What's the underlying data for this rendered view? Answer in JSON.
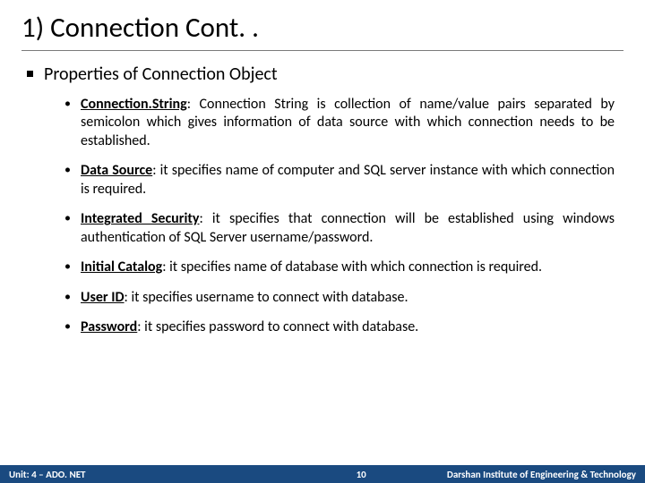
{
  "title": "1) Connection Cont. .",
  "section_heading": "Properties of Connection Object",
  "items": [
    {
      "term": "Connection.String",
      "desc": ": Connection String is collection of name/value pairs separated by semicolon which gives information of data source with which connection needs to be established."
    },
    {
      "term": "Data Source",
      "desc": ": it specifies name of computer and SQL server instance with which connection is required."
    },
    {
      "term": "Integrated Security",
      "desc": ": it specifies that connection will be established using windows authentication of SQL Server username/password."
    },
    {
      "term": "Initial Catalog",
      "desc": ": it specifies name of database with which connection is required."
    },
    {
      "term": "User ID",
      "desc": ": it specifies username to connect with database."
    },
    {
      "term": "Password",
      "desc": ": it specifies password to connect with database."
    }
  ],
  "footer": {
    "left": "Unit: 4 – ADO. NET",
    "page": "10",
    "right": "Darshan Institute of Engineering & Technology"
  }
}
